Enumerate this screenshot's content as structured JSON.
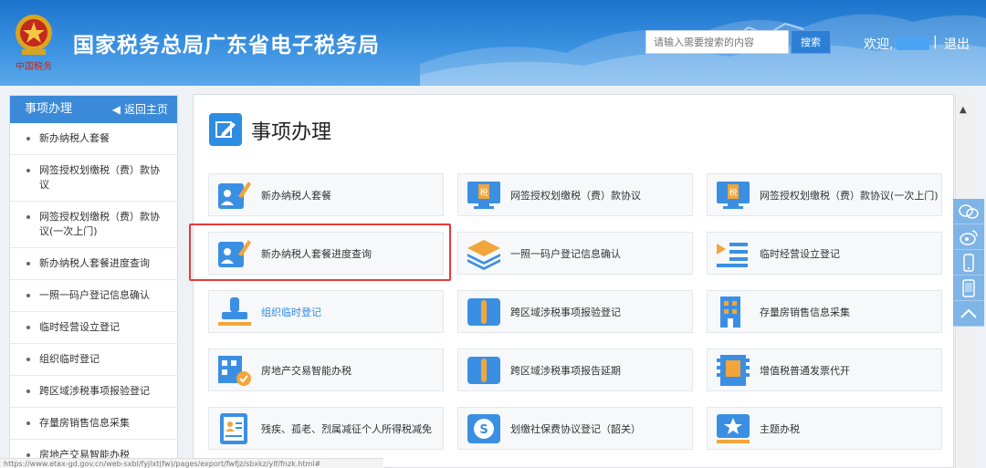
{
  "header": {
    "emblem_text": "中国税务",
    "site_title": "国家税务总局广东省电子税务局",
    "search": {
      "placeholder": "请输入需要搜索的内容",
      "button_label": "搜索"
    },
    "welcome": "欢迎,",
    "separator": "|",
    "logout": "退出"
  },
  "sidebar": {
    "title": "事项办理",
    "back_label": "返回主页",
    "items": [
      "新办纳税人套餐",
      "网签授权划缴税（费）款协议",
      "网签授权划缴税（费）款协议(一次上门)",
      "新办纳税人套餐进度查询",
      "一照一码户登记信息确认",
      "临时经营设立登记",
      "组织临时登记",
      "跨区域涉税事项报验登记",
      "存量房销售信息采集",
      "房地产交易智能办税"
    ]
  },
  "main": {
    "title": "事项办理",
    "tiles": [
      {
        "label": "新办纳税人套餐",
        "icon": "person-edit-icon"
      },
      {
        "label": "网签授权划缴税（费）款协议",
        "icon": "monitor-tax-icon"
      },
      {
        "label": "网签授权划缴税（费）款协议(一次上门)",
        "icon": "monitor-tax-icon"
      },
      {
        "label": "新办纳税人套餐进度查询",
        "icon": "person-edit-icon"
      },
      {
        "label": "一照一码户登记信息确认",
        "icon": "layers-icon"
      },
      {
        "label": "临时经营设立登记",
        "icon": "list-arrow-icon"
      },
      {
        "label": "组织临时登记",
        "icon": "stamp-icon"
      },
      {
        "label": "跨区域涉税事项报验登记",
        "icon": "book-icon"
      },
      {
        "label": "存量房销售信息采集",
        "icon": "building-icon"
      },
      {
        "label": "房地产交易智能办税",
        "icon": "building-check-icon"
      },
      {
        "label": "跨区域涉税事项报告延期",
        "icon": "book-icon"
      },
      {
        "label": "增值税普通发票代开",
        "icon": "invoice-icon"
      },
      {
        "label": "残疾、孤老、烈属减征个人所得税减免",
        "icon": "person-doc-icon"
      },
      {
        "label": "划缴社保费协议登记（韶关）",
        "icon": "social-security-icon"
      },
      {
        "label": "主题办税",
        "icon": "star-icon"
      }
    ]
  },
  "statusbar": {
    "url": "https://www.etax-gd.gov.cn/web-sxbl/fyjlxt(fw)/pages/export/fwfjz/sbxkz/ylf/fnzk.html#"
  },
  "colors": {
    "header_blue": "#1d73cc",
    "accent_blue": "#2d8de2",
    "highlight_red": "#e53a3a"
  }
}
